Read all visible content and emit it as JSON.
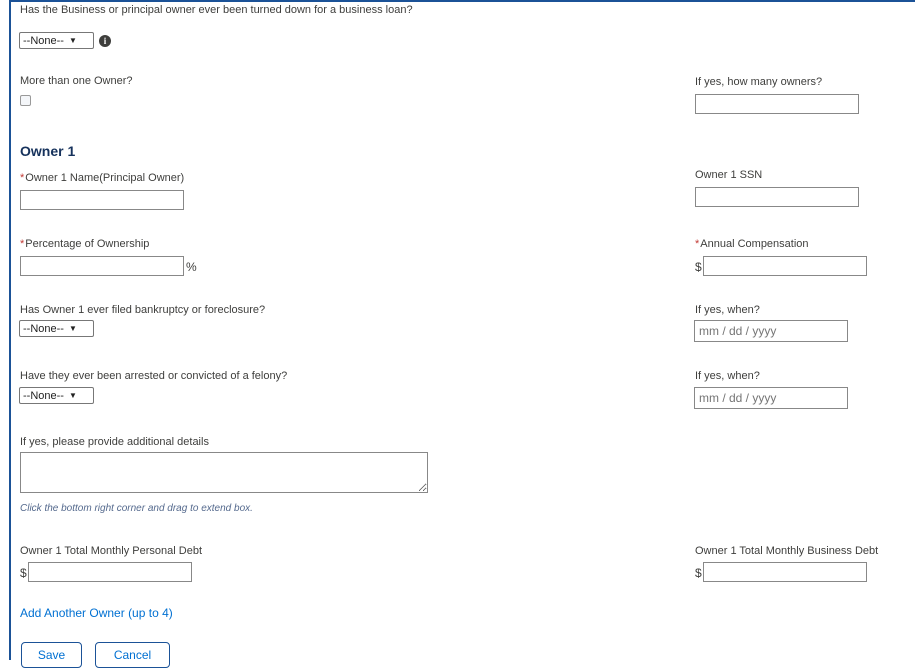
{
  "loan_question": {
    "label": "Has the Business or principal owner ever been turned down for a business loan?",
    "select_value": "--None--"
  },
  "multiple_owners": {
    "label": "More than one Owner?",
    "checked": false,
    "count_label": "If yes, how many owners?",
    "count_value": ""
  },
  "owner_section": {
    "title": "Owner 1",
    "required_mark": "*",
    "name_label": "Owner 1 Name(Principal Owner)",
    "name_value": "",
    "ssn_label": "Owner 1 SSN",
    "ssn_value": "",
    "percentage_label": "Percentage of Ownership",
    "percentage_value": "",
    "percent_suffix": "%",
    "compensation_label": "Annual Compensation",
    "currency_symbol": "$",
    "compensation_value": "",
    "bankruptcy_label": "Has Owner 1 ever filed bankruptcy or foreclosure?",
    "bankruptcy_select": "--None--",
    "bankruptcy_when_label": "If yes, when?",
    "bankruptcy_when_placeholder": "mm / dd / yyyy",
    "felony_label": "Have they ever been arrested or convicted of a felony?",
    "felony_select": "--None--",
    "felony_when_label": "If yes, when?",
    "felony_when_placeholder": "mm / dd / yyyy",
    "details_label": "If yes, please provide additional details",
    "details_value": "",
    "details_hint": "Click the bottom right corner and drag to extend box.",
    "personal_debt_label": "Owner 1 Total Monthly Personal Debt",
    "personal_debt_value": "",
    "business_debt_label": "Owner 1 Total Monthly Business Debt",
    "business_debt_value": ""
  },
  "add_owner_link": "Add Another Owner (up to 4)",
  "buttons": {
    "save": "Save",
    "cancel": "Cancel"
  },
  "icons": {
    "info": "info-icon",
    "dropdown": "chevron-down-icon"
  },
  "colors": {
    "accent": "#0070d2",
    "heading": "#16325c",
    "required": "#c23934",
    "border": "#1b5297"
  }
}
